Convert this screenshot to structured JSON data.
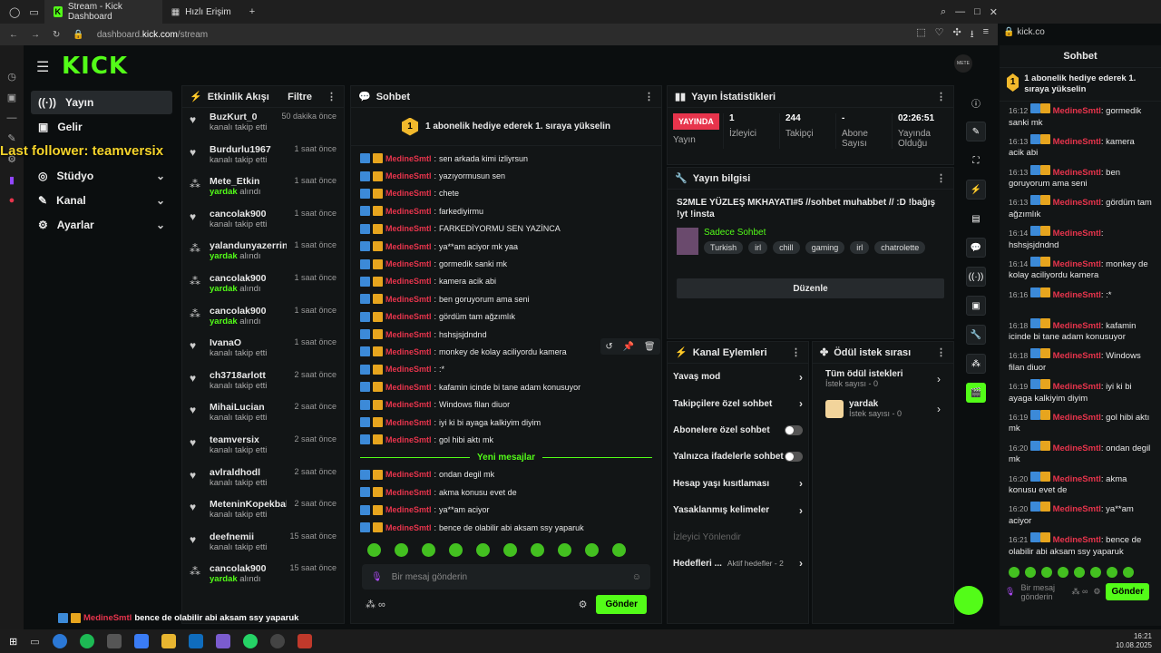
{
  "browser": {
    "tabs": [
      {
        "label": "Stream - Kick Dashboard"
      },
      {
        "label": "Hızlı Erişim"
      }
    ],
    "url_prefix": "dashboard.",
    "url_domain": "kick.com",
    "url_path": "/stream",
    "side_url": "kick.co"
  },
  "app": {
    "logo": "KICK"
  },
  "overlay": {
    "follower_text": "Last follower: teamversix"
  },
  "nav": [
    {
      "label": "Yayın"
    },
    {
      "label": "Gelir"
    },
    {
      "label": "Stüdyo"
    },
    {
      "label": "Kanal"
    },
    {
      "label": "Ayarlar"
    }
  ],
  "activity": {
    "title": "Etkinlik Akışı",
    "filter": "Filtre",
    "items": [
      {
        "name": "BuzKurt_0",
        "sub": "kanalı takip etti",
        "time": "50 dakika önce",
        "kind": "follow"
      },
      {
        "name": "Burdurlu1967",
        "sub": "kanalı takip etti",
        "time": "1 saat önce",
        "kind": "follow"
      },
      {
        "name": "Mete_Etkin",
        "hl": "yardak",
        "sub": "alındı",
        "time": "1 saat önce",
        "kind": "reward"
      },
      {
        "name": "cancolak900",
        "sub": "kanalı takip etti",
        "time": "1 saat önce",
        "kind": "follow"
      },
      {
        "name": "yalandunyazerriniffet",
        "hl": "yardak",
        "sub": "alındı",
        "time": "1 saat önce",
        "kind": "reward"
      },
      {
        "name": "cancolak900",
        "hl": "yardak",
        "sub": "alındı",
        "time": "1 saat önce",
        "kind": "reward"
      },
      {
        "name": "cancolak900",
        "hl": "yardak",
        "sub": "alındı",
        "time": "1 saat önce",
        "kind": "reward"
      },
      {
        "name": "IvanaO",
        "sub": "kanalı takip etti",
        "time": "1 saat önce",
        "kind": "follow"
      },
      {
        "name": "ch3718arlott",
        "sub": "kanalı takip etti",
        "time": "2 saat önce",
        "kind": "follow"
      },
      {
        "name": "MihaiLucian",
        "sub": "kanalı takip etti",
        "time": "2 saat önce",
        "kind": "follow"
      },
      {
        "name": "teamversix",
        "sub": "kanalı takip etti",
        "time": "2 saat önce",
        "kind": "follow"
      },
      {
        "name": "avlraldhodl",
        "sub": "kanalı takip etti",
        "time": "2 saat önce",
        "kind": "follow"
      },
      {
        "name": "MeteninKopekbaliklisort31",
        "sub": "kanalı takip etti",
        "time": "2 saat önce",
        "kind": "follow"
      },
      {
        "name": "deefnemii",
        "sub": "kanalı takip etti",
        "time": "15 saat önce",
        "kind": "follow"
      },
      {
        "name": "cancolak900",
        "hl": "yardak",
        "sub": "alındı",
        "time": "15 saat önce",
        "kind": "reward"
      }
    ]
  },
  "chat": {
    "title": "Sohbet",
    "pinned": "1 abonelik hediye ederek 1. sıraya yükselin",
    "pinned_num": "1",
    "user": "MedineSmtl",
    "messages": [
      "sen arkada kimi izliyrsun",
      "yazıyormusun sen",
      "chete",
      "farkediyirmu",
      "FARKEDİYORMU SEN YAZİNCA",
      "ya**am aciyor mk yaa",
      "gormedik sanki mk",
      "kamera acik abi",
      "ben goruyorum ama seni",
      "gördüm tam ağzımlık",
      "hshsjsjdndnd",
      "monkey de kolay aciliyordu kamera",
      ":*",
      "kafamin icinde bi tane adam konusuyor",
      "Windows filan diuor",
      "iyi ki bi ayaga kalkiyim diyim",
      "gol hibi aktı mk"
    ],
    "new_label": "Yeni mesajlar",
    "new_messages": [
      "ondan degil mk",
      "akma konusu evet de",
      "ya**am aciyor",
      "bence de olabilir abi aksam ssy yaparuk"
    ],
    "placeholder": "Bir mesaj gönderin",
    "send": "Gönder"
  },
  "stats": {
    "title": "Yayın İstatistikleri",
    "live": "YAYINDA",
    "live_label": "Yayın",
    "viewers": "1",
    "viewers_label": "İzleyici",
    "followers": "244",
    "followers_label": "Takipçi",
    "subs": "-",
    "subs_label": "Abone Sayısı",
    "uptime": "02:26:51",
    "uptime_label": "Yayında Olduğu"
  },
  "info": {
    "title": "Yayın bilgisi",
    "stream_title": "S2MLE YÜZLEŞ MKHAYATI#5 //sohbet muhabbet // :D !bağış !yt !insta",
    "category": "Sadece Sohbet",
    "tags": [
      "Turkish",
      "irl",
      "chill",
      "gaming",
      "irl",
      "chatrolette"
    ],
    "edit": "Düzenle"
  },
  "actions": {
    "title": "Kanal Eylemleri",
    "slow": "Yavaş mod",
    "followers_only": "Takipçilere özel sohbet",
    "subs_only": "Abonelere özel sohbet",
    "emotes_only": "Yalnızca ifadelerle sohbet",
    "age": "Hesap yaşı kısıtlaması",
    "banned": "Yasaklanmış kelimeler",
    "redirect": "İzleyici Yönlendir",
    "goals": "Hedefleri ...",
    "goals_active": "Aktif hedefler - 2"
  },
  "rewards": {
    "title": "Ödül istek sırası",
    "all": "Tüm ödül istekleri",
    "all_count": "İstek sayısı - 0",
    "item": "yardak",
    "item_count": "İstek sayısı - 0"
  },
  "right_chat": {
    "title": "Sohbet",
    "pinned": "1 abonelik hediye ederek 1. sıraya yükselin",
    "user": "MedineSmtl",
    "messages": [
      {
        "t": "16:12",
        "m": "gormedik sanki mk"
      },
      {
        "t": "16:13",
        "m": "kamera acik abi"
      },
      {
        "t": "16:13",
        "m": "ben goruyorum ama seni"
      },
      {
        "t": "16:13",
        "m": "gördüm tam ağzımlık"
      },
      {
        "t": "16:14",
        "m": "hshsjsjdndnd"
      },
      {
        "t": "16:14",
        "m": "monkey de kolay aciliyordu kamera"
      },
      {
        "t": "16:16",
        "m": ":*"
      },
      {
        "t": "16:18",
        "m": "kafamin icinde bi tane adam konusuyor"
      },
      {
        "t": "16:18",
        "m": "Windows filan diuor"
      },
      {
        "t": "16:19",
        "m": "iyi ki bi ayaga kalkiyim diyim"
      },
      {
        "t": "16:19",
        "m": "gol hibi aktı mk"
      },
      {
        "t": "16:20",
        "m": "ondan degil mk"
      },
      {
        "t": "16:20",
        "m": "akma konusu evet de"
      },
      {
        "t": "16:20",
        "m": "ya**am aciyor"
      },
      {
        "t": "16:21",
        "m": "bence de olabilir abi aksam ssy yaparuk"
      }
    ],
    "placeholder": "Bir mesaj gönderin",
    "send": "Gönder"
  },
  "bottom_note": {
    "user": "MedineSmtl",
    "text": "bence de olabilir abi aksam ssy yaparuk"
  },
  "taskbar": {
    "time": "16:21",
    "date": "10.08.2025"
  }
}
